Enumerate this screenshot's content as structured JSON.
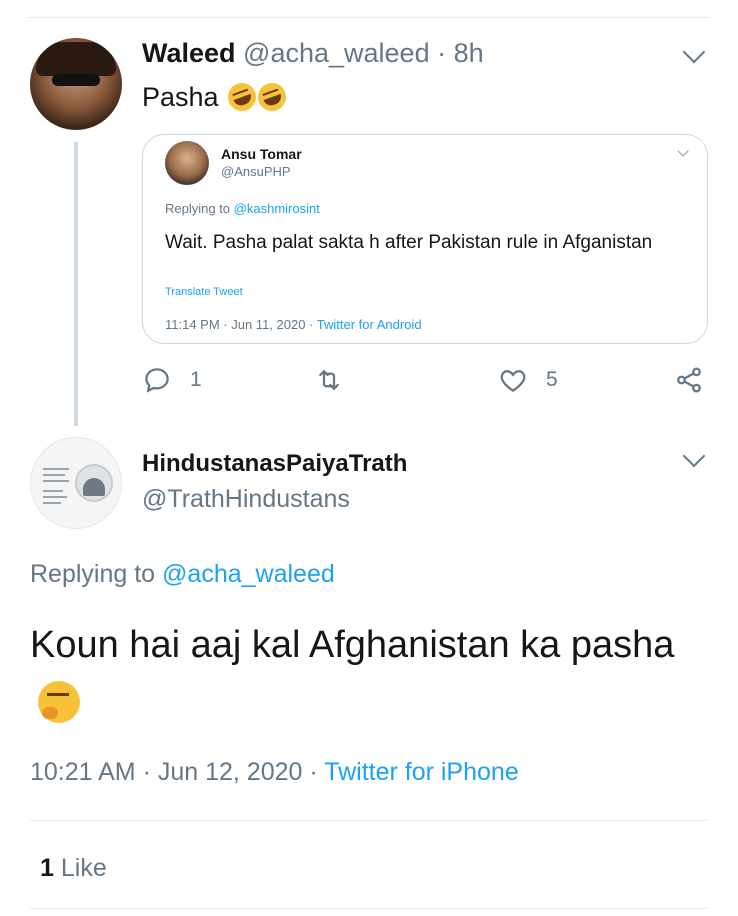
{
  "tweet": {
    "author_name": "Waleed",
    "author_handle": "@acha_waleed",
    "separator": "·",
    "age": "8h",
    "text": "Pasha",
    "text_emoji": "rolling-on-floor-laughing",
    "quote": {
      "author_name": "Ansu Tomar",
      "author_handle": "@AnsuPHP",
      "replying_label": "Replying to",
      "replying_handle": "@kashmirosint",
      "text": "Wait. Pasha palat sakta h after Pakistan rule in Afganistan",
      "translate_label": "Translate Tweet",
      "timestamp": "11:14 PM · Jun 11, 2020 ·",
      "source": "Twitter for Android"
    },
    "actions": {
      "reply_count": "1",
      "retweet_count": "",
      "like_count": "5",
      "icons": [
        "reply-icon",
        "retweet-icon",
        "like-icon",
        "share-icon"
      ]
    }
  },
  "reply_tweet": {
    "author_name": "HindustanasPaiyaTrath",
    "author_handle": "@TrathHindustans",
    "replying_label": "Replying to",
    "replying_handle": "@acha_waleed",
    "text": "Koun hai aaj kal Afghanistan ka pasha",
    "text_emoji": "thinking-face",
    "timestamp": "10:21 AM · Jun 12, 2020 ·",
    "source": "Twitter for iPhone",
    "likes_count": "1",
    "likes_label": "Like"
  },
  "colors": {
    "link": "#1da1f2",
    "secondary_text": "#657786",
    "primary_text": "#14171a",
    "divider": "#e6ecf0"
  }
}
